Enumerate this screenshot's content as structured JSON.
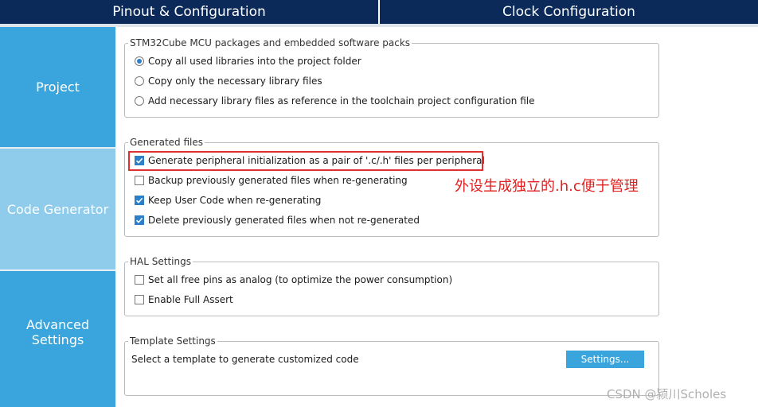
{
  "tabs": [
    {
      "label": "Pinout & Configuration"
    },
    {
      "label": "Clock Configuration"
    }
  ],
  "sidebar": {
    "items": [
      {
        "label": "Project"
      },
      {
        "label": "Code Generator"
      },
      {
        "label": "Advanced Settings"
      }
    ]
  },
  "packages": {
    "legend": "STM32Cube MCU packages and embedded software packs",
    "options": [
      {
        "label": "Copy all used libraries into the project folder",
        "selected": true
      },
      {
        "label": "Copy only the necessary library files",
        "selected": false
      },
      {
        "label": "Add necessary library files as reference in the toolchain project configuration file",
        "selected": false
      }
    ]
  },
  "generated": {
    "legend": "Generated files",
    "options": [
      {
        "label": "Generate peripheral initialization as a pair of '.c/.h' files per peripheral",
        "checked": true
      },
      {
        "label": "Backup previously generated files when re-generating",
        "checked": false
      },
      {
        "label": "Keep User Code when re-generating",
        "checked": true
      },
      {
        "label": "Delete previously generated files when not re-generated",
        "checked": true
      }
    ]
  },
  "hal": {
    "legend": "HAL Settings",
    "options": [
      {
        "label": "Set all free pins as analog (to optimize the power consumption)",
        "checked": false
      },
      {
        "label": "Enable Full Assert",
        "checked": false
      }
    ]
  },
  "template": {
    "legend": "Template Settings",
    "description": "Select a template to generate customized code",
    "button_label": "Settings..."
  },
  "annotation": {
    "text": "外设生成独立的.h.c便于管理"
  },
  "watermark": "CSDN @颍川Scholes",
  "colors": {
    "topbar": "#0b2a5a",
    "sidebar": "#3aa5dc",
    "sidebar_active": "#8fcbeb",
    "accent": "#2c7fc9",
    "annotation": "#e02020"
  }
}
